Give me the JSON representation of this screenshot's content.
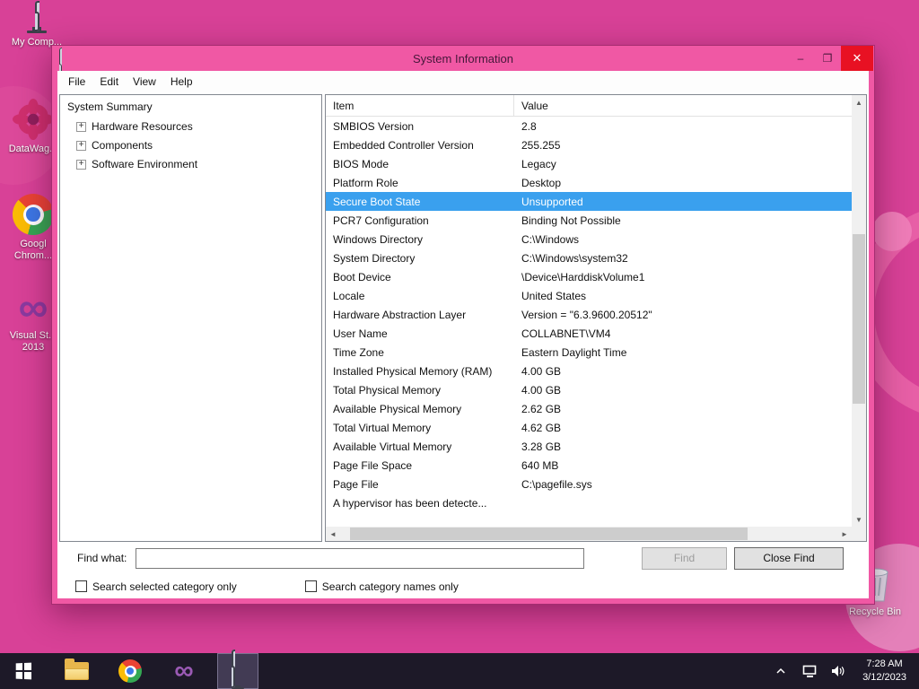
{
  "desktop": {
    "icons": [
      {
        "label": "My Comp..."
      },
      {
        "label": "DataWag..."
      },
      {
        "label": "Googl Chrom..."
      },
      {
        "label": "Visual St... 2013"
      },
      {
        "label": "Recycle Bin"
      }
    ]
  },
  "window": {
    "title": "System Information",
    "caption": {
      "minimize": "–",
      "maximize": "❐",
      "close": "✕"
    },
    "menu": [
      "File",
      "Edit",
      "View",
      "Help"
    ],
    "tree": {
      "root": "System Summary",
      "expand_glyph": "+",
      "items": [
        "Hardware Resources",
        "Components",
        "Software Environment"
      ]
    },
    "list": {
      "columns": [
        "Item",
        "Value"
      ],
      "selected_index": 4,
      "rows": [
        [
          "SMBIOS Version",
          "2.8"
        ],
        [
          "Embedded Controller Version",
          "255.255"
        ],
        [
          "BIOS Mode",
          "Legacy"
        ],
        [
          "Platform Role",
          "Desktop"
        ],
        [
          "Secure Boot State",
          "Unsupported"
        ],
        [
          "PCR7 Configuration",
          "Binding Not Possible"
        ],
        [
          "Windows Directory",
          "C:\\Windows"
        ],
        [
          "System Directory",
          "C:\\Windows\\system32"
        ],
        [
          "Boot Device",
          "\\Device\\HarddiskVolume1"
        ],
        [
          "Locale",
          "United States"
        ],
        [
          "Hardware Abstraction Layer",
          "Version = \"6.3.9600.20512\""
        ],
        [
          "User Name",
          "COLLABNET\\VM4"
        ],
        [
          "Time Zone",
          "Eastern Daylight Time"
        ],
        [
          "Installed Physical Memory (RAM)",
          "4.00 GB"
        ],
        [
          "Total Physical Memory",
          "4.00 GB"
        ],
        [
          "Available Physical Memory",
          "2.62 GB"
        ],
        [
          "Total Virtual Memory",
          "4.62 GB"
        ],
        [
          "Available Virtual Memory",
          "3.28 GB"
        ],
        [
          "Page File Space",
          "640 MB"
        ],
        [
          "Page File",
          "C:\\pagefile.sys"
        ],
        [
          "A hypervisor has been detecte...",
          ""
        ]
      ]
    },
    "scroll": {
      "up": "▲",
      "down": "▼",
      "left": "◄",
      "right": "►"
    },
    "find": {
      "label": "Find what:",
      "input_value": "",
      "find_button": "Find",
      "close_find_button": "Close Find",
      "check1": "Search selected category only",
      "check2": "Search category names only"
    }
  },
  "taskbar": {
    "time": "7:28 AM",
    "date": "3/12/2023"
  }
}
